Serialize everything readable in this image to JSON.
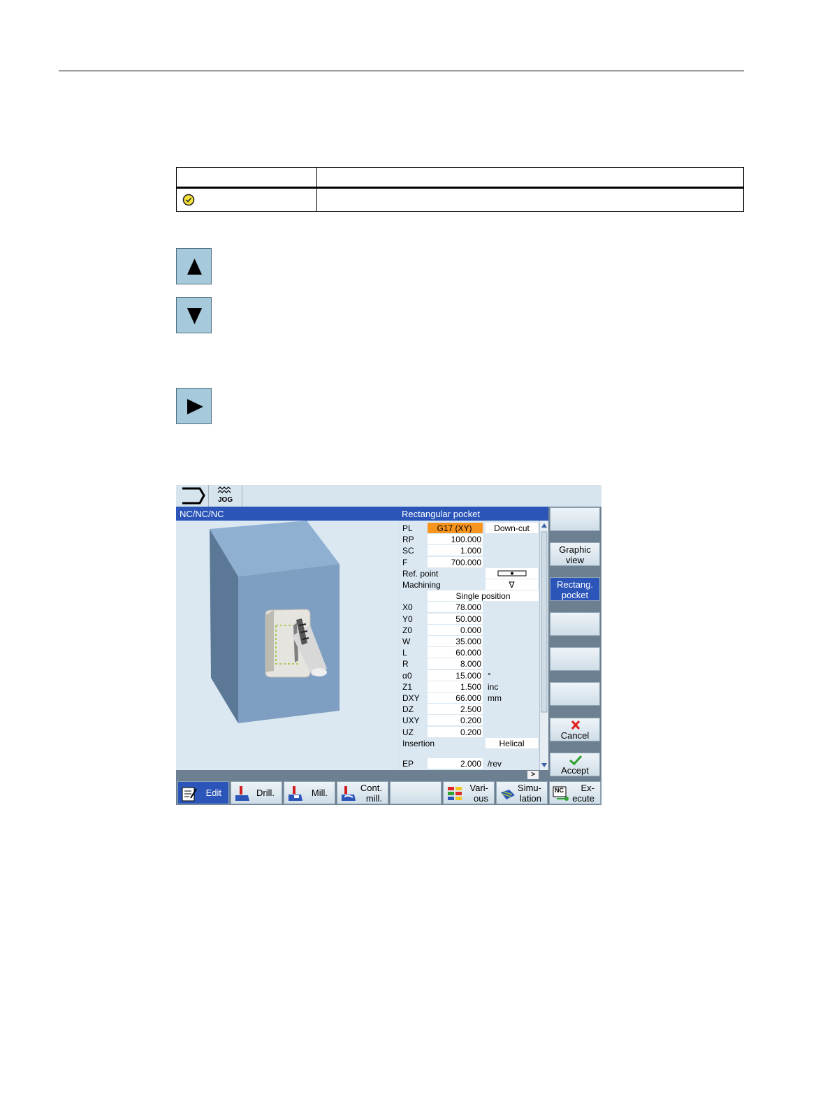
{
  "hmi": {
    "title_left": "NC/NC/NC",
    "title_right": "Rectangular pocket",
    "mode_label": "JOG",
    "form": {
      "rows": [
        {
          "label": "PL",
          "value": "G17 (XY)",
          "unit": "Down-cut",
          "selected": true
        },
        {
          "label": "RP",
          "value": "100.000",
          "unit": ""
        },
        {
          "label": "SC",
          "value": "1.000",
          "unit": ""
        },
        {
          "label": "F",
          "value": "700.000",
          "unit": ""
        },
        {
          "label": "Ref. point",
          "value": "",
          "unit": ""
        },
        {
          "label": "Machining",
          "value": "",
          "unit": "∇"
        },
        {
          "label": "",
          "value": "Single position",
          "unit": ""
        },
        {
          "label": "X0",
          "value": "78.000",
          "unit": ""
        },
        {
          "label": "Y0",
          "value": "50.000",
          "unit": ""
        },
        {
          "label": "Z0",
          "value": "0.000",
          "unit": ""
        },
        {
          "label": "W",
          "value": "35.000",
          "unit": ""
        },
        {
          "label": "L",
          "value": "60.000",
          "unit": ""
        },
        {
          "label": "R",
          "value": "8.000",
          "unit": ""
        },
        {
          "label": "α0",
          "value": "15.000",
          "unit": "°"
        },
        {
          "label": "Z1",
          "value": "1.500",
          "unit": "inc"
        },
        {
          "label": "DXY",
          "value": "66.000",
          "unit": "mm"
        },
        {
          "label": "DZ",
          "value": "2.500",
          "unit": ""
        },
        {
          "label": "UXY",
          "value": "0.200",
          "unit": ""
        },
        {
          "label": "UZ",
          "value": "0.200",
          "unit": ""
        },
        {
          "label": "Insertion",
          "value": "",
          "unit": "Helical"
        },
        {
          "label": "EP",
          "value": "2.000",
          "unit": "/rev"
        }
      ]
    },
    "vertical_softkeys": {
      "k1": "",
      "k2_l1": "Graphic",
      "k2_l2": "view",
      "k3_l1": "Rectang.",
      "k3_l2": "pocket",
      "k4": "",
      "k5": "",
      "k6": "",
      "cancel": "Cancel",
      "accept": "Accept"
    },
    "horizontal_softkeys": {
      "edit": "Edit",
      "drill": "Drill.",
      "mill": "Mill.",
      "cont_l1": "Cont.",
      "cont_l2": "mill.",
      "blank": "",
      "various_l1": "Vari-",
      "various_l2": "ous",
      "sim_l1": "Simu-",
      "sim_l2": "lation",
      "exec_l1": "Ex-",
      "exec_l2": "ecute",
      "nc_badge": "NC"
    },
    "scroll_arrow": ">"
  },
  "colors": {
    "title_bar": "#2b55b8",
    "selected_field": "#f7941d",
    "key_face": "#a6cadc"
  }
}
